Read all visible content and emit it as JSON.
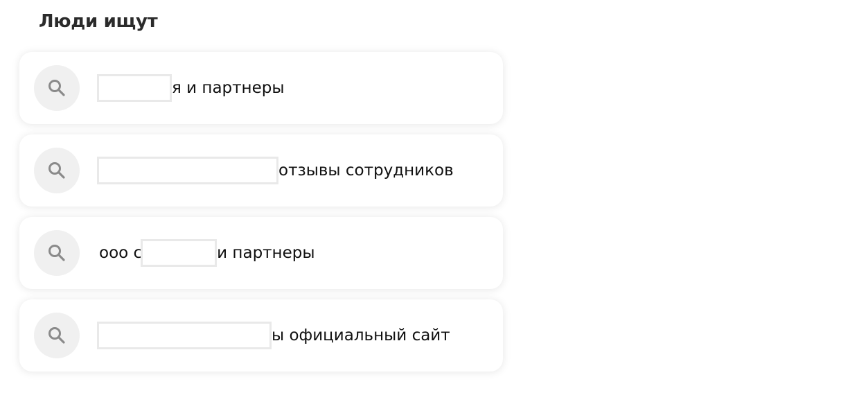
{
  "section": {
    "title": "Люди ищут"
  },
  "suggestions": [
    {
      "prefix": "",
      "suffix": "я и партнеры"
    },
    {
      "prefix": "",
      "suffix": "отзывы сотрудников"
    },
    {
      "prefix": "ооо с",
      "suffix": "и партнеры"
    },
    {
      "prefix": "",
      "suffix": "ы официальный сайт"
    }
  ],
  "icons": {
    "search": "search-icon"
  },
  "colors": {
    "icon_circle": "#f0f0f0",
    "icon_glyph": "#8a8a8a",
    "title": "#2b2b2b",
    "redaction_border": "#e9e9e9"
  }
}
